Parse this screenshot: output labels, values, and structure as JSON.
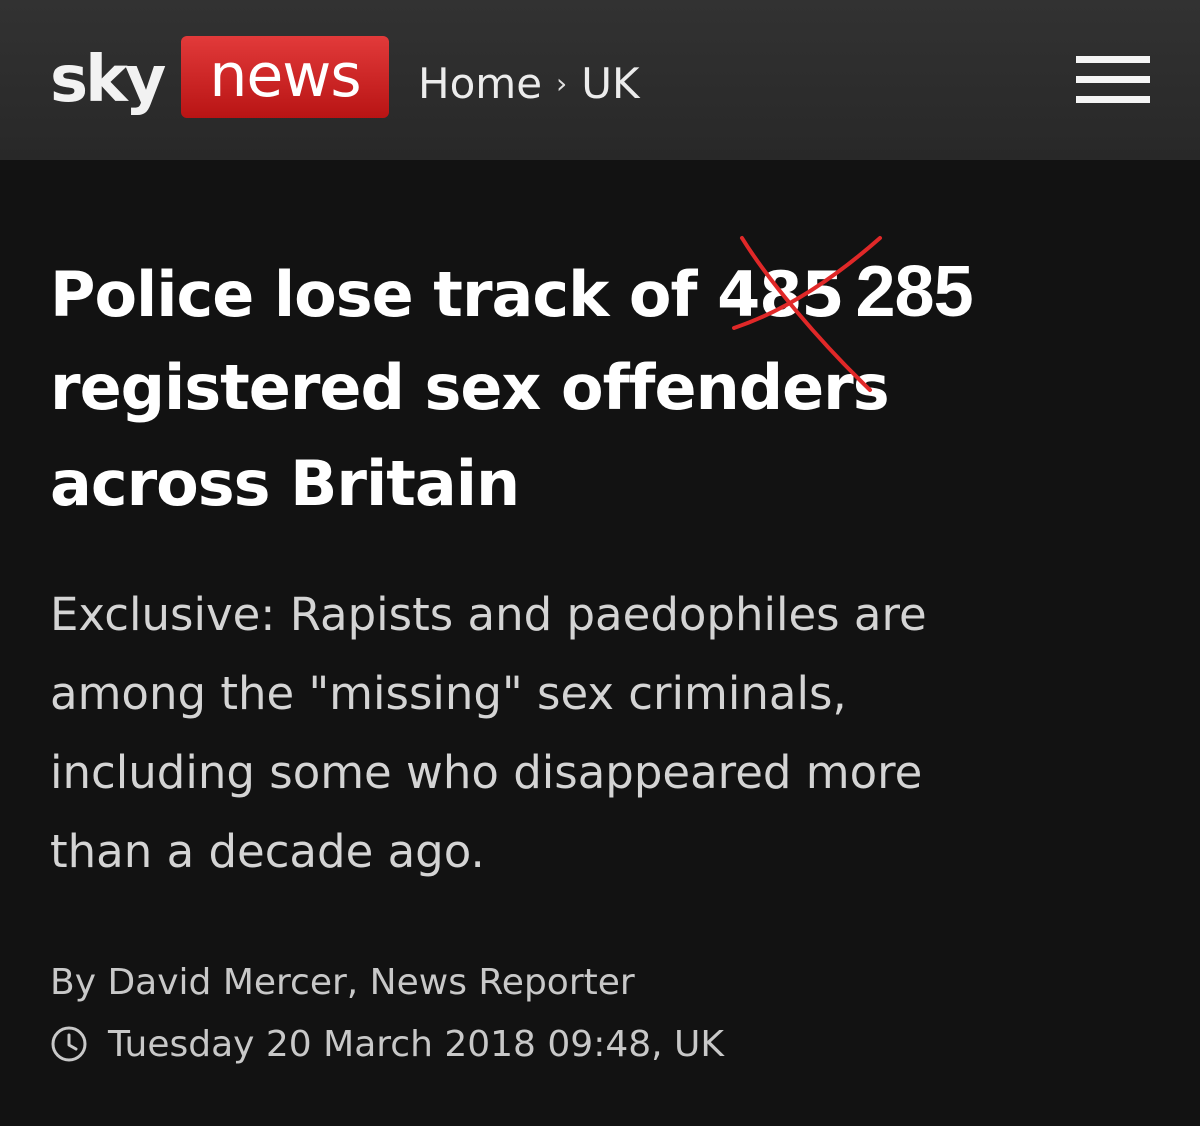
{
  "header": {
    "logo_sky": "sky",
    "logo_news": "news",
    "breadcrumb": [
      "Home",
      "UK"
    ],
    "breadcrumb_separator": "›",
    "menu_icon": "hamburger-menu-icon",
    "brand_red": "#d42020"
  },
  "article": {
    "headline_lines": [
      {
        "text": "Police lose track of ",
        "struck": "485",
        "correction": "285"
      },
      {
        "text": "registered sex offenders"
      },
      {
        "text": "across Britain"
      }
    ],
    "standfirst_lines": [
      "Exclusive: Rapists and paedophiles are",
      "among the \"missing\" sex criminals,",
      "including some who disappeared more",
      "than a decade ago."
    ],
    "byline": "By David Mercer, News Reporter",
    "timestamp": "Tuesday 20 March 2018 09:48, UK",
    "timestamp_icon": "clock-icon",
    "annotation_color": "#e02828"
  }
}
